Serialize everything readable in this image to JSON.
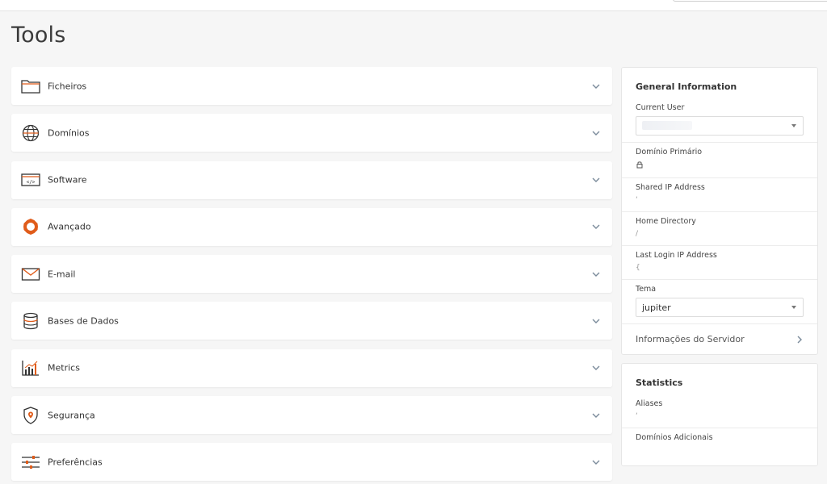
{
  "page": {
    "title": "Tools"
  },
  "colors": {
    "accent": "#e05c1a",
    "icon_dark": "#333333"
  },
  "groups": [
    {
      "label": "Ficheiros",
      "icon": "folder-icon"
    },
    {
      "label": "Domínios",
      "icon": "globe-icon"
    },
    {
      "label": "Software",
      "icon": "code-window-icon"
    },
    {
      "label": "Avançado",
      "icon": "gear-icon"
    },
    {
      "label": "E-mail",
      "icon": "envelope-icon"
    },
    {
      "label": "Bases de Dados",
      "icon": "database-icon"
    },
    {
      "label": "Metrics",
      "icon": "bar-chart-icon"
    },
    {
      "label": "Segurança",
      "icon": "shield-icon"
    },
    {
      "label": "Preferências",
      "icon": "sliders-icon"
    }
  ],
  "general_info": {
    "title": "General Information",
    "current_user_label": "Current User",
    "primary_domain_label": "Domínio Primário",
    "shared_ip_label": "Shared IP Address",
    "shared_ip_value": "‘",
    "home_dir_label": "Home Directory",
    "home_dir_value": "/",
    "last_login_label": "Last Login IP Address",
    "last_login_value": "{",
    "theme_label": "Tema",
    "theme_value": "jupiter",
    "server_info_link": "Informações do Servidor"
  },
  "statistics": {
    "title": "Statistics",
    "aliases_label": "Aliases",
    "aliases_value": "‘",
    "addon_domains_label": "Domínios Adicionais"
  }
}
